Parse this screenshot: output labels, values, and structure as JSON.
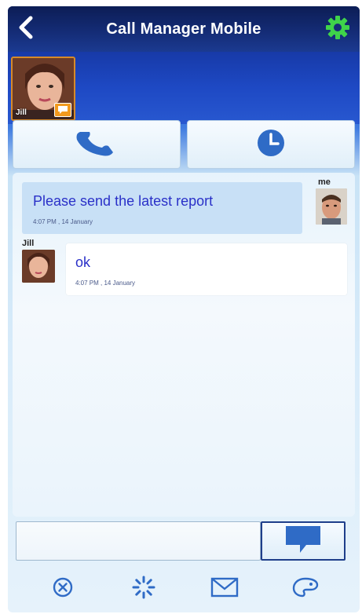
{
  "header": {
    "title": "Call Manager Mobile",
    "back_icon": "chevron-left-icon",
    "settings_icon": "gear-icon"
  },
  "contact": {
    "name": "Jill",
    "avatar_icon": "contact-avatar",
    "badge_icon": "chat-bubble-icon"
  },
  "actions": [
    {
      "icon": "phone-icon"
    },
    {
      "icon": "clock-icon"
    }
  ],
  "messages": [
    {
      "sender": "me",
      "text": "Please send the latest report",
      "time": "4:07 PM , 14 January"
    },
    {
      "sender": "Jill",
      "text": "ok",
      "time": "4:07 PM , 14 January"
    }
  ],
  "compose": {
    "value": "",
    "placeholder": "",
    "send_icon": "speech-bubble-icon"
  },
  "toolbar": [
    {
      "icon": "close-circle-icon"
    },
    {
      "icon": "loading-spinner-icon"
    },
    {
      "icon": "mail-icon"
    },
    {
      "icon": "palette-icon"
    }
  ],
  "colors": {
    "header_bg": "#152d78",
    "accent_green": "#3fd34a",
    "message_text": "#2a30c8",
    "icon_blue": "#2f6bc6"
  }
}
